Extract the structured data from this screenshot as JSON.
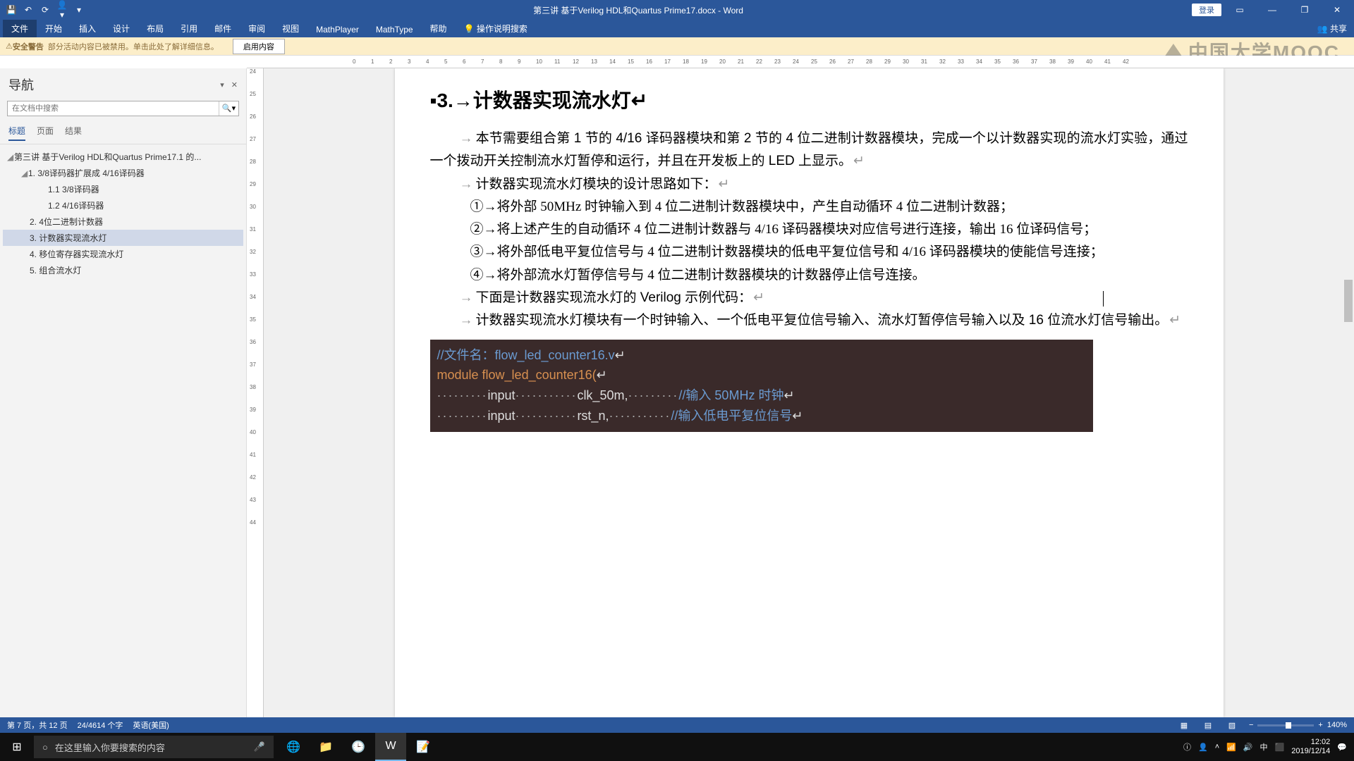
{
  "title": "第三讲 基于Verilog HDL和Quartus Prime17.docx - Word",
  "login": "登录",
  "share": "共享",
  "tabs": [
    "文件",
    "开始",
    "插入",
    "设计",
    "布局",
    "引用",
    "邮件",
    "审阅",
    "视图",
    "MathPlayer",
    "MathType",
    "帮助"
  ],
  "tell_me": "操作说明搜索",
  "infobar": {
    "label": "安全警告",
    "msg": "部分活动内容已被禁用。单击此处了解详细信息。",
    "btn": "启用内容"
  },
  "watermark": "中国大学MOOC",
  "nav": {
    "title": "导航",
    "search_ph": "在文档中搜索",
    "subtabs": [
      "标题",
      "页面",
      "结果"
    ],
    "tree": [
      {
        "l": 0,
        "t": "第三讲 基于Verilog HDL和Quartus Prime17.1 的...",
        "c": true
      },
      {
        "l": 1,
        "t": "1. 3/8译码器扩展成 4/16译码器",
        "c": true
      },
      {
        "l": 2,
        "t": "1.1 3/8译码器"
      },
      {
        "l": 2,
        "t": "1.2 4/16译码器"
      },
      {
        "l": 1,
        "t": "2. 4位二进制计数器"
      },
      {
        "l": 1,
        "t": "3. 计数器实现流水灯",
        "sel": true
      },
      {
        "l": 1,
        "t": "4. 移位寄存器实现流水灯"
      },
      {
        "l": 1,
        "t": "5. 组合流水灯"
      }
    ]
  },
  "doc": {
    "heading_num": "3.",
    "heading": "计数器实现流水灯",
    "p1": "本节需要组合第 1 节的 4/16 译码器模块和第 2 节的 4 位二进制计数器模块，完成一个以计数器实现的流水灯实验，通过一个拨动开关控制流水灯暂停和运行，并且在开发板上的 LED 上显示。",
    "p2": "计数器实现流水灯模块的设计思路如下：",
    "i1": "①→将外部 50MHz 时钟输入到 4 位二进制计数器模块中，产生自动循环 4 位二进制计数器；",
    "i2": "②→将上述产生的自动循环 4 位二进制计数器与 4/16 译码器模块对应信号进行连接，输出 16 位译码信号；",
    "i3": "③→将外部低电平复位信号与 4 位二进制计数器模块的低电平复位信号和 4/16 译码器模块的使能信号连接；",
    "i4": "④→将外部流水灯暂停信号与 4 位二进制计数器模块的计数器停止信号连接。",
    "p3": "下面是计数器实现流水灯的 Verilog 示例代码：",
    "p4": "计数器实现流水灯模块有一个时钟输入、一个低电平复位信号输入、流水灯暂停信号输入以及 16 位流水灯信号输出。",
    "code": {
      "l1": "//文件名：flow_led_counter16.v",
      "l2": "module flow_led_counter16(",
      "l3a": "input",
      "l3b": "clk_50m,",
      "l3c": "//输入 50MHz 时钟",
      "l4a": "input",
      "l4b": "rst_n,",
      "l4c": "//输入低电平复位信号"
    }
  },
  "status": {
    "page": "第 7 页，共 12 页",
    "words": "24/4614 个字",
    "lang": "英语(美国)",
    "zoom": "140%"
  },
  "taskbar": {
    "search_ph": "在这里输入你要搜索的内容",
    "time": "12:02",
    "date": "2019/12/14"
  }
}
